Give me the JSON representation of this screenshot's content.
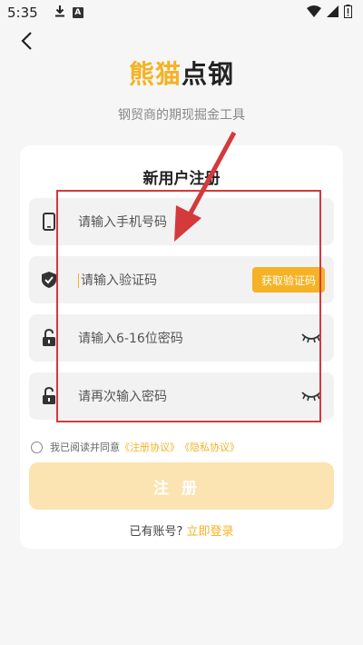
{
  "status_bar": {
    "time": "5:35",
    "a_badge": "A"
  },
  "brand": {
    "accent_text": "熊猫",
    "dark_text": "点钢"
  },
  "subtitle": "钢贸商的期现掘金工具",
  "form": {
    "title": "新用户注册",
    "phone_placeholder": "请输入手机号码",
    "code_placeholder": "请输入验证码",
    "get_code_label": "获取验证码",
    "password_placeholder": "请输入6-16位密码",
    "confirm_placeholder": "请再次输入密码"
  },
  "agreement": {
    "prefix": "我已阅读并同意",
    "register_link": "《注册协议》",
    "privacy_link": "《隐私协议》"
  },
  "register_button": "注册",
  "login": {
    "prompt": "已有账号?",
    "link": "立即登录"
  },
  "colors": {
    "accent": "#f5b225",
    "button_disabled": "#fbe3b2",
    "annotation": "#d4393b"
  },
  "icons": [
    "back-icon",
    "phone-icon",
    "shield-check-icon",
    "lock-icon",
    "eye-closed-icon",
    "wifi-icon",
    "signal-icon",
    "battery-icon",
    "download-icon"
  ]
}
